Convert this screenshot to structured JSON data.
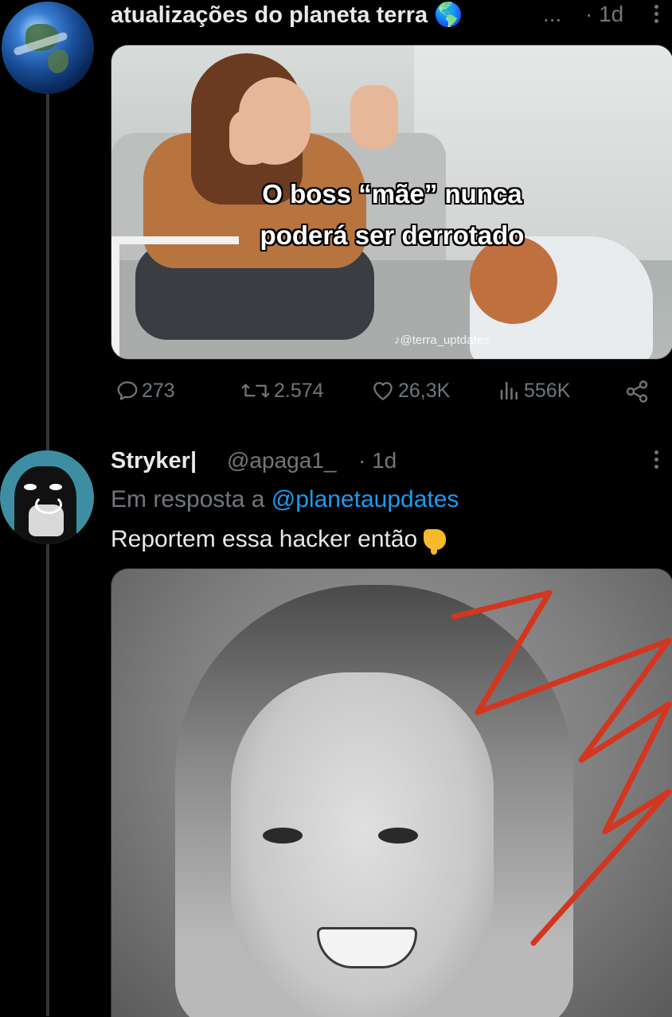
{
  "tweet1": {
    "author_name": "atualizações do planeta terra 🌎",
    "truncation": "...",
    "time": "· 1d",
    "media": {
      "caption_line1": "O boss “mãe” nunca",
      "caption_line2": "poderá ser derrotado",
      "watermark": "@terra_uptdates"
    },
    "actions": {
      "replies": "273",
      "reposts": "2.574",
      "likes": "26,3K",
      "views": "556K"
    }
  },
  "tweet2": {
    "author_name": "Stryker|",
    "handle": "@apaga1_",
    "time": "· 1d",
    "reply_prefix": "Em resposta a",
    "reply_to": "@planetaupdates",
    "text": "Reportem essa hacker então"
  },
  "colors": {
    "background": "#000000",
    "text_primary": "#e7e9ea",
    "text_secondary": "#71767b",
    "link": "#1d9bf0",
    "thread_line": "#333639"
  },
  "icons": [
    "earth-avatar",
    "more-icon",
    "reply-icon",
    "repost-icon",
    "like-icon",
    "views-icon",
    "share-icon",
    "pointing-down-emoji"
  ]
}
